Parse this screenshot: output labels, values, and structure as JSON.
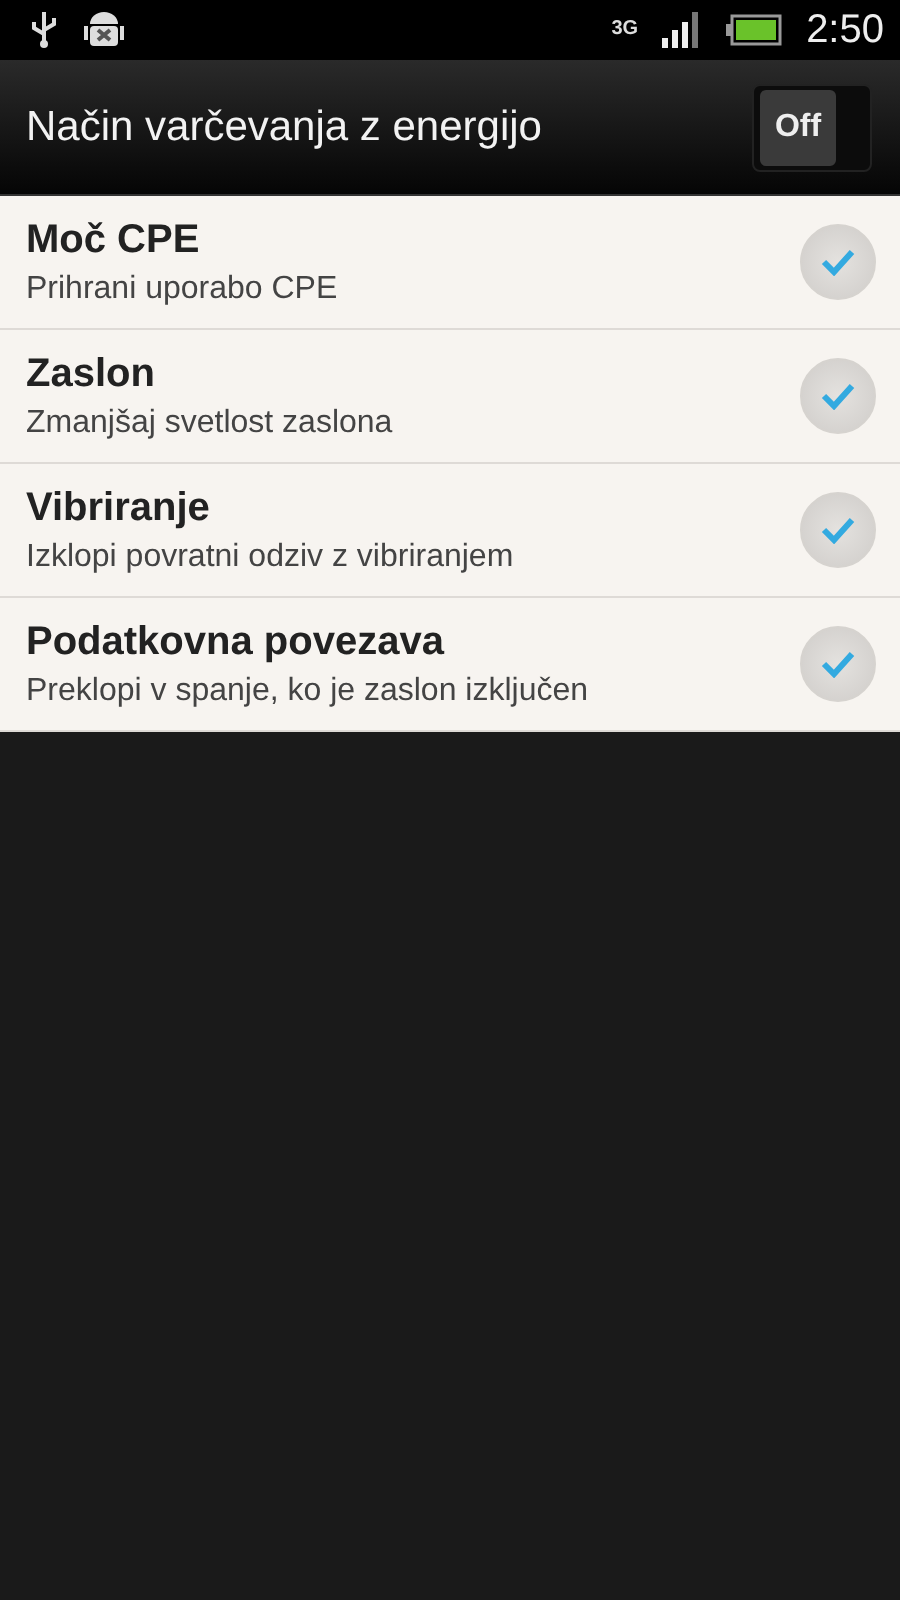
{
  "status_bar": {
    "network": "3G",
    "time": "2:50"
  },
  "header": {
    "title": "Način varčevanja z energijo",
    "toggle": {
      "label": "Off",
      "on": false
    }
  },
  "items": [
    {
      "title": "Moč CPE",
      "subtitle": "Prihrani uporabo CPE",
      "checked": true
    },
    {
      "title": "Zaslon",
      "subtitle": "Zmanjšaj svetlost zaslona",
      "checked": true
    },
    {
      "title": "Vibriranje",
      "subtitle": "Izklopi povratni odziv z vibriranjem",
      "checked": true
    },
    {
      "title": "Podatkovna povezava",
      "subtitle": "Preklopi v spanje, ko je zaslon izključen",
      "checked": true
    }
  ]
}
